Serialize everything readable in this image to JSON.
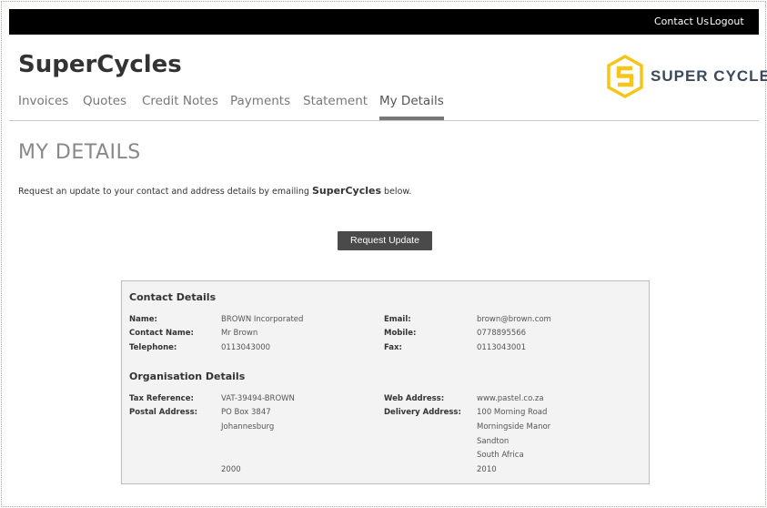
{
  "header": {
    "contact_us": "Contact Us",
    "logout": "Logout"
  },
  "brand": {
    "name": "SuperCycles"
  },
  "logo": {
    "text": "SUPER CYCLE",
    "color": "#f5c518"
  },
  "nav": {
    "tabs": [
      {
        "label": "Invoices"
      },
      {
        "label": "Quotes"
      },
      {
        "label": "Credit Notes"
      },
      {
        "label": "Payments"
      },
      {
        "label": "Statement"
      },
      {
        "label": "My Details",
        "active": true
      }
    ]
  },
  "page": {
    "title": "MY DETAILS",
    "intro_before": "Request an update to your contact and address details by emailing ",
    "intro_company": "SuperCycles",
    "intro_after": " below.",
    "request_button": "Request Update"
  },
  "contact": {
    "heading": "Contact Details",
    "name_label": "Name:",
    "name": "BROWN Incorporated",
    "contact_name_label": "Contact Name:",
    "contact_name": "Mr Brown",
    "telephone_label": "Telephone:",
    "telephone": "0113043000",
    "email_label": "Email:",
    "email": "brown@brown.com",
    "mobile_label": "Mobile:",
    "mobile": "0778895566",
    "fax_label": "Fax:",
    "fax": "0113043001"
  },
  "organisation": {
    "heading": "Organisation Details",
    "tax_label": "Tax Reference:",
    "tax": "VAT-39494-BROWN",
    "postal_label": "Postal Address:",
    "postal": [
      "PO Box 3847",
      "Johannesburg",
      "",
      "",
      "2000"
    ],
    "web_label": "Web Address:",
    "web": "www.pastel.co.za",
    "delivery_label": "Delivery Address:",
    "delivery": [
      "100 Morning Road",
      "Morningside Manor",
      "Sandton",
      "South Africa",
      "2010"
    ]
  }
}
